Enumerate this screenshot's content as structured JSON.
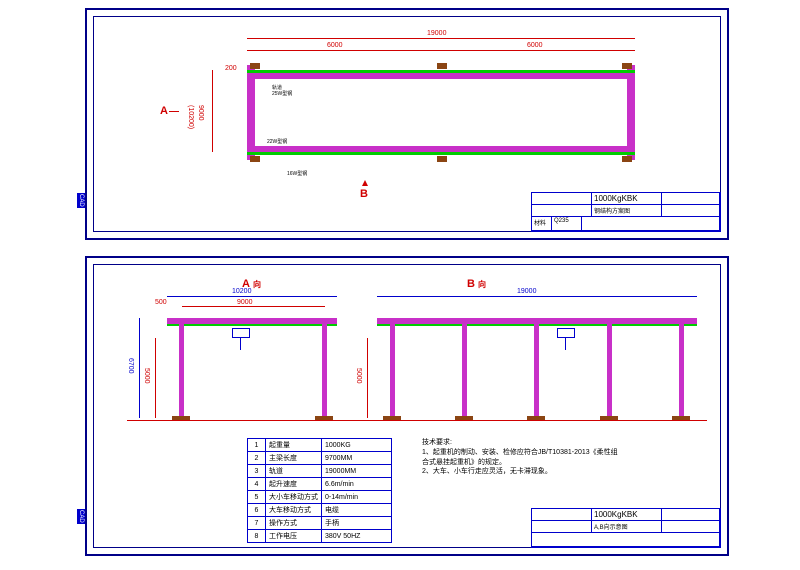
{
  "drawing1": {
    "title": "1000KgKBK",
    "subtitle": "钢结构方案图",
    "material": "Q235",
    "dim_total": "19000",
    "dim_span1": "6000",
    "dim_span2": "6000",
    "dim_height": "9000",
    "dim_small": "200",
    "dim_width": "(10200)",
    "label_a": "A",
    "label_b": "B",
    "cross_label1": "轨道",
    "cross_label2": "25W型钢",
    "cross_label3": "22W型钢",
    "base_label": "16W型钢"
  },
  "drawing2": {
    "title": "1000KgKBK",
    "subtitle": "A,B向示意图",
    "label_a": "A",
    "label_a_dir": "向",
    "label_b": "B",
    "label_b_dir": "向",
    "dim_10200": "10200",
    "dim_9000": "9000",
    "dim_500": "500",
    "dim_6700": "6700",
    "dim_5000": "5000",
    "dim_19000": "19000",
    "dim_5000b": "5000"
  },
  "specs": [
    {
      "n": "1",
      "k": "起重量",
      "v": "1000KG"
    },
    {
      "n": "2",
      "k": "主梁长度",
      "v": "9700MM"
    },
    {
      "n": "3",
      "k": "轨道",
      "v": "19000MM"
    },
    {
      "n": "4",
      "k": "起升速度",
      "v": "6.6m/min"
    },
    {
      "n": "5",
      "k": "大小车移动方式",
      "v": "0-14m/min"
    },
    {
      "n": "6",
      "k": "大车移动方式",
      "v": "电缆"
    },
    {
      "n": "7",
      "k": "操作方式",
      "v": "手柄"
    },
    {
      "n": "8",
      "k": "工作电压",
      "v": "380V  50HZ"
    }
  ],
  "requirements": {
    "heading": "技术要求:",
    "line1": "1、起重机的制动、安装、检修应符合JB/T10381-2013《柔性组合式悬挂起重机》的规定。",
    "line2": "2、大车、小车行走应灵活，无卡滞现象。"
  },
  "side": "CAD"
}
